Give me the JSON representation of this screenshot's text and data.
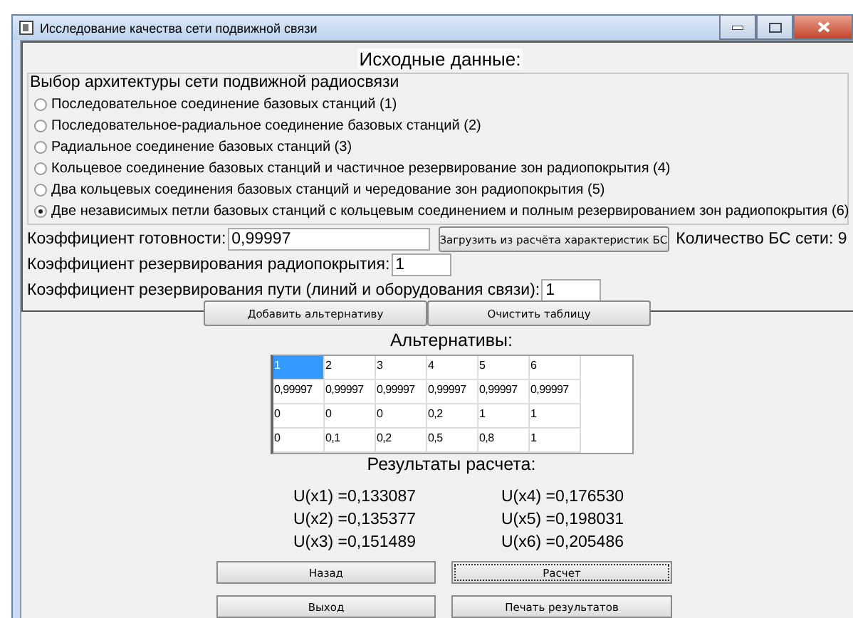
{
  "window": {
    "title": "Исследование качества сети подвижной связи"
  },
  "input_panel": {
    "heading": "Исходные данные:",
    "architecture": {
      "title": "Выбор архитектуры сети подвижной радиосвязи",
      "options": [
        {
          "label": "Последовательное соединение базовых станций (1)",
          "selected": false
        },
        {
          "label": "Последовательное-радиальное соединение базовых станций (2)",
          "selected": false
        },
        {
          "label": "Радиальное соединение базовых станций (3)",
          "selected": false
        },
        {
          "label": "Кольцевое соединение базовых станций и частичное резервирование зон радиопокрытия (4)",
          "selected": false
        },
        {
          "label": "Два кольцевых соединения базовых станций и чередование зон радиопокрытия (5)",
          "selected": false
        },
        {
          "label": "Две независимых петли базовых станций с кольцевым соединением и полным резервированием зон радиопокрытия (6)",
          "selected": true
        }
      ]
    },
    "availability": {
      "label": "Коэффициент готовности:",
      "value": "0,99997"
    },
    "load_button": "Загрузить из расчёта характеристик БС",
    "bs_count": "Количество БС сети: 9",
    "coverage_reserve": {
      "label": "Коэффициент резервирования радиопокрытия:",
      "value": "1"
    },
    "path_reserve": {
      "label": "Коэффициент резервирования пути (линий и оборудования связи):",
      "value": "1"
    }
  },
  "table_buttons": [
    "Добавить альтернативу",
    "Очистить таблицу"
  ],
  "alternatives": {
    "title": "Альтернативы:",
    "rows": [
      {
        "cells": [
          {
            "text": "1",
            "selected": true
          },
          {
            "text": "2",
            "selected": false
          },
          {
            "text": "3",
            "selected": false
          },
          {
            "text": "4",
            "selected": false
          },
          {
            "text": "5",
            "selected": false
          },
          {
            "text": "6",
            "selected": false
          }
        ]
      },
      {
        "cells": [
          {
            "text": "0,99997",
            "selected": false
          },
          {
            "text": "0,99997",
            "selected": false
          },
          {
            "text": "0,99997",
            "selected": false
          },
          {
            "text": "0,99997",
            "selected": false
          },
          {
            "text": "0,99997",
            "selected": false
          },
          {
            "text": "0,99997",
            "selected": false
          }
        ]
      },
      {
        "cells": [
          {
            "text": "0",
            "selected": false
          },
          {
            "text": "0",
            "selected": false
          },
          {
            "text": "0",
            "selected": false
          },
          {
            "text": "0,2",
            "selected": false
          },
          {
            "text": "1",
            "selected": false
          },
          {
            "text": "1",
            "selected": false
          }
        ]
      },
      {
        "cells": [
          {
            "text": "0",
            "selected": false
          },
          {
            "text": "0,1",
            "selected": false
          },
          {
            "text": "0,2",
            "selected": false
          },
          {
            "text": "0,5",
            "selected": false
          },
          {
            "text": "0,8",
            "selected": false
          },
          {
            "text": "1",
            "selected": false
          }
        ]
      }
    ]
  },
  "results": {
    "title": "Результаты расчета:",
    "columns": [
      [
        "U(x1) =0,133087",
        "U(x2) =0,135377",
        "U(x3) =0,151489"
      ],
      [
        "U(x4) =0,176530",
        "U(x5) =0,198031",
        "U(x6) =0,205486"
      ]
    ]
  },
  "buttons": [
    {
      "label": "Назад",
      "focused": false
    },
    {
      "label": "Расчет",
      "focused": true
    },
    {
      "label": "Выход",
      "focused": false
    },
    {
      "label": "Печать результатов",
      "focused": false
    }
  ]
}
